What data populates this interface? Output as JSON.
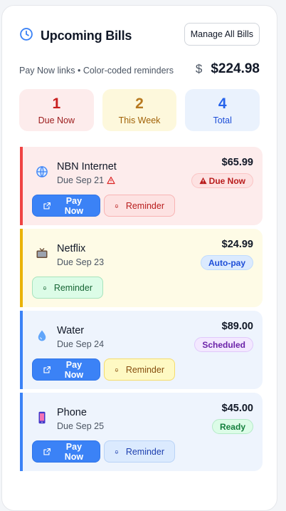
{
  "header": {
    "title": "Upcoming Bills",
    "manage_label": "Manage All Bills"
  },
  "summary": {
    "subtitle": "Pay Now links • Color-coded reminders",
    "currency_symbol": "$",
    "total": "$224.98"
  },
  "stats": [
    {
      "value": "1",
      "label": "Due Now"
    },
    {
      "value": "2",
      "label": "This Week"
    },
    {
      "value": "4",
      "label": "Total"
    }
  ],
  "bills": [
    {
      "icon": "globe-icon",
      "name": "NBN Internet",
      "due": "Due Sep 21",
      "amount": "$65.99",
      "status": "Due Now",
      "pay_label": "Pay Now",
      "reminder_label": "Reminder"
    },
    {
      "icon": "tv-icon",
      "name": "Netflix",
      "due": "Due Sep 23",
      "amount": "$24.99",
      "status": "Auto-pay",
      "reminder_label": "Reminder"
    },
    {
      "icon": "droplet-icon",
      "name": "Water",
      "due": "Due Sep 24",
      "amount": "$89.00",
      "status": "Scheduled",
      "pay_label": "Pay Now",
      "reminder_label": "Reminder"
    },
    {
      "icon": "phone-icon",
      "name": "Phone",
      "due": "Due Sep 25",
      "amount": "$45.00",
      "status": "Ready",
      "pay_label": "Pay Now",
      "reminder_label": "Reminder"
    }
  ],
  "colors": {
    "due_now": "#ef4444",
    "this_week": "#eab308",
    "total": "#3b82f6",
    "pay_button": "#3b82f6",
    "auto_pay": "#2563eb",
    "scheduled": "#7c3aed",
    "ready": "#15803d"
  }
}
